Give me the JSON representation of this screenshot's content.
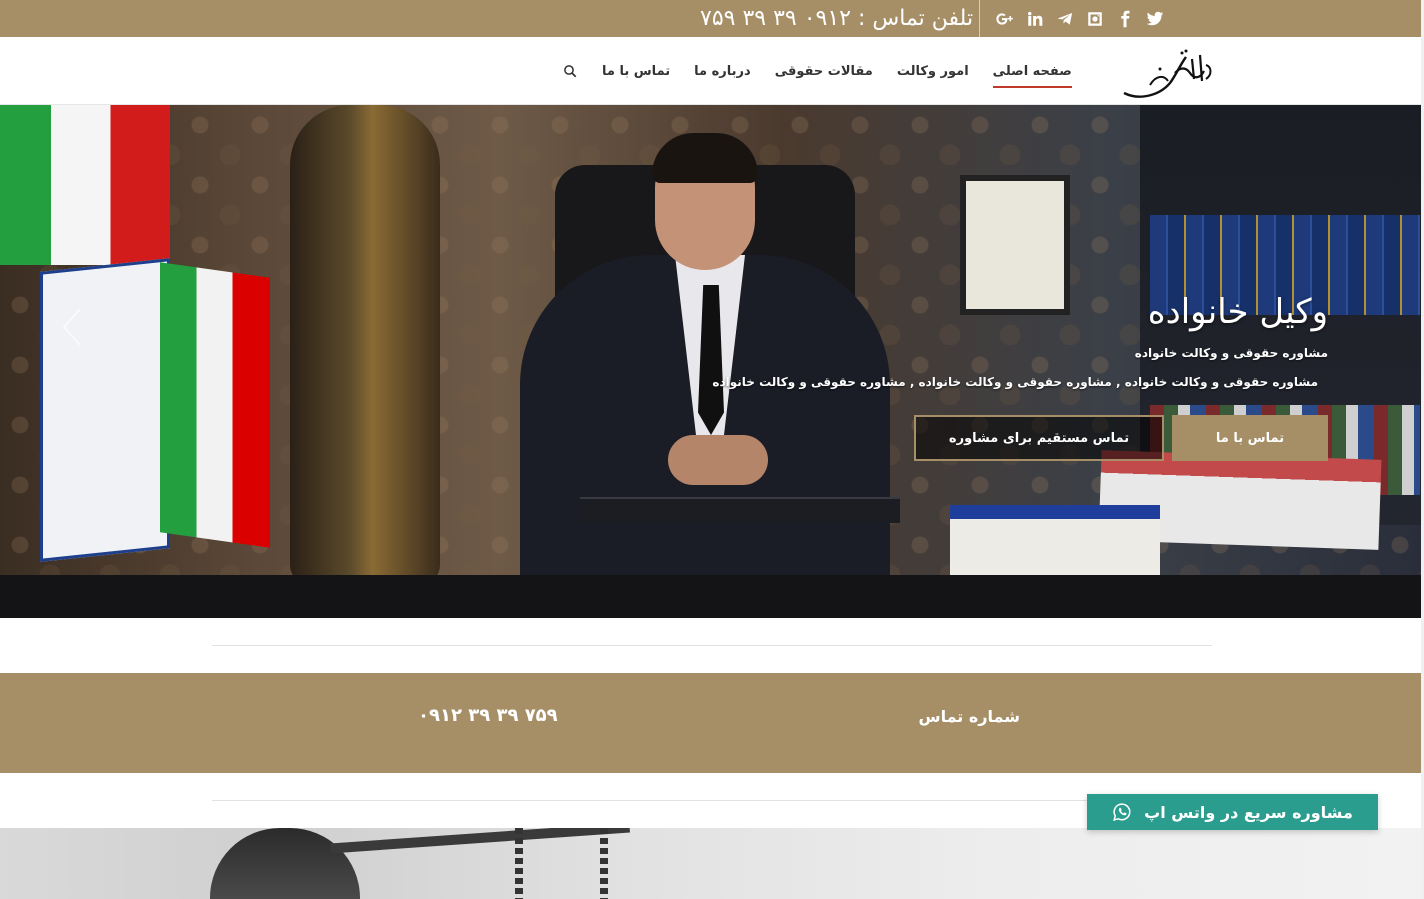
{
  "colors": {
    "gold": "#a68f67",
    "nav_active_underline": "#c0392b",
    "whatsapp_green": "#2a9d8f"
  },
  "topbar": {
    "phone_text": "تلفن تماس : ۰۹۱۲ ۳۹ ۳۹ ۷۵۹",
    "social_icons": [
      "twitter-icon",
      "facebook-icon",
      "instagram-icon",
      "telegram-icon",
      "linkedin-icon",
      "google-plus-icon"
    ]
  },
  "nav": {
    "items": [
      {
        "label": "صفحه اصلی",
        "active": true
      },
      {
        "label": "امور وکالت",
        "active": false
      },
      {
        "label": "مقالات حقوقی",
        "active": false
      },
      {
        "label": "درباره ما",
        "active": false
      },
      {
        "label": "تماس با ما",
        "active": false
      }
    ],
    "search_icon": "search-icon"
  },
  "hero": {
    "title": "وکیل خانواده",
    "subtitle": "مشاوره حقوقی و وکالت خانواده",
    "description": "مشاوره حقوقی و وکالت خانواده , مشاوره حقوقی و وکالت خانواده , مشاوره حقوقی و وکالت خانواده",
    "primary_button": "تماس با ما",
    "secondary_button": "تماس مستقیم برای مشاوره"
  },
  "contact": {
    "label": "شماره تماس",
    "phone": "۰۹۱۲ ۳۹ ۳۹ ۷۵۹"
  },
  "whatsapp": {
    "label": "مشاوره سریع در واتس اپ"
  }
}
